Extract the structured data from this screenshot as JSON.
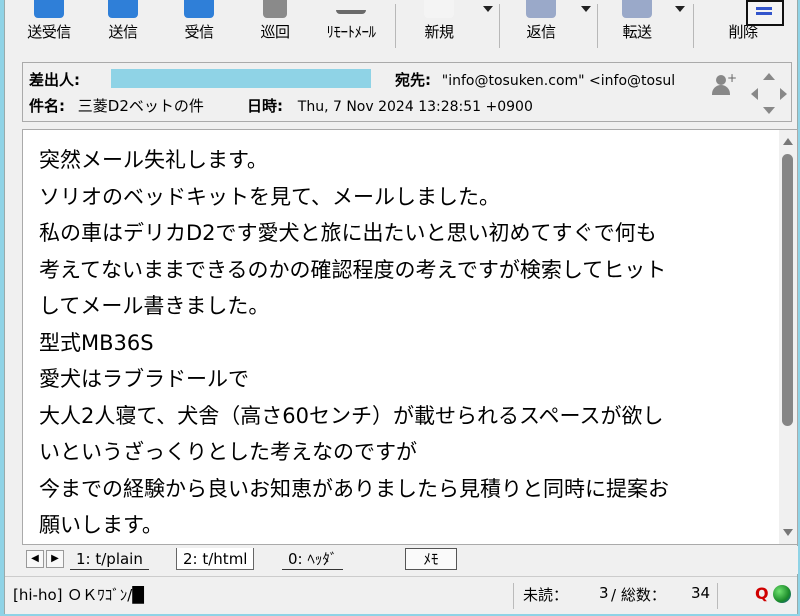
{
  "toolbar": {
    "items": [
      {
        "label": "送受信",
        "icon": "send-receive-icon"
      },
      {
        "label": "送信",
        "icon": "send-icon"
      },
      {
        "label": "受信",
        "icon": "receive-icon"
      },
      {
        "label": "巡回",
        "icon": "patrol-icon"
      },
      {
        "label": "ﾘﾓｰﾄﾒｰﾙ",
        "icon": "remote-mail-icon"
      },
      {
        "label": "新規",
        "icon": "new-mail-icon"
      },
      {
        "label": "返信",
        "icon": "reply-icon"
      },
      {
        "label": "転送",
        "icon": "forward-icon"
      },
      {
        "label": "削除",
        "icon": "delete-icon"
      }
    ]
  },
  "header": {
    "from_label": "差出人:",
    "to_label": "宛先:",
    "to_value": "\"info@tosuken.com\" <info@tosul",
    "subject_label": "件名:",
    "subject_value": "三菱D2ベットの件",
    "date_label": "日時:",
    "date_value": "Thu, 7 Nov 2024 13:28:51 +0900"
  },
  "body": {
    "lines": [
      "突然メール失礼します。",
      "ソリオのベッドキットを見て、メールしました。",
      "私の車はデリカD2です愛犬と旅に出たいと思い初めてすぐで何も",
      "考えてないままできるのかの確認程度の考えですが検索してヒット",
      "してメール書きました。",
      "型式MB36S",
      "愛犬はラブラドールで",
      "大人2人寝て、犬舎（高さ60センチ）が載せられるスペースが欲し",
      "いというざっくりとした考えなのですが",
      "今までの経験から良いお知恵がありましたら見積りと同時に提案お",
      "願いします。"
    ]
  },
  "tabs": {
    "items": [
      "1: t/plain",
      "2: t/html",
      "0: ﾍｯﾀﾞ"
    ],
    "memo_label": "ﾒﾓ"
  },
  "status": {
    "left": "[hi-ho] ＯＫﾜｺﾞﾝ/█",
    "unread_label": "未読：",
    "unread_value": "3",
    "total_label": "/ 総数：",
    "total_value": "34",
    "q_label": "Q"
  }
}
